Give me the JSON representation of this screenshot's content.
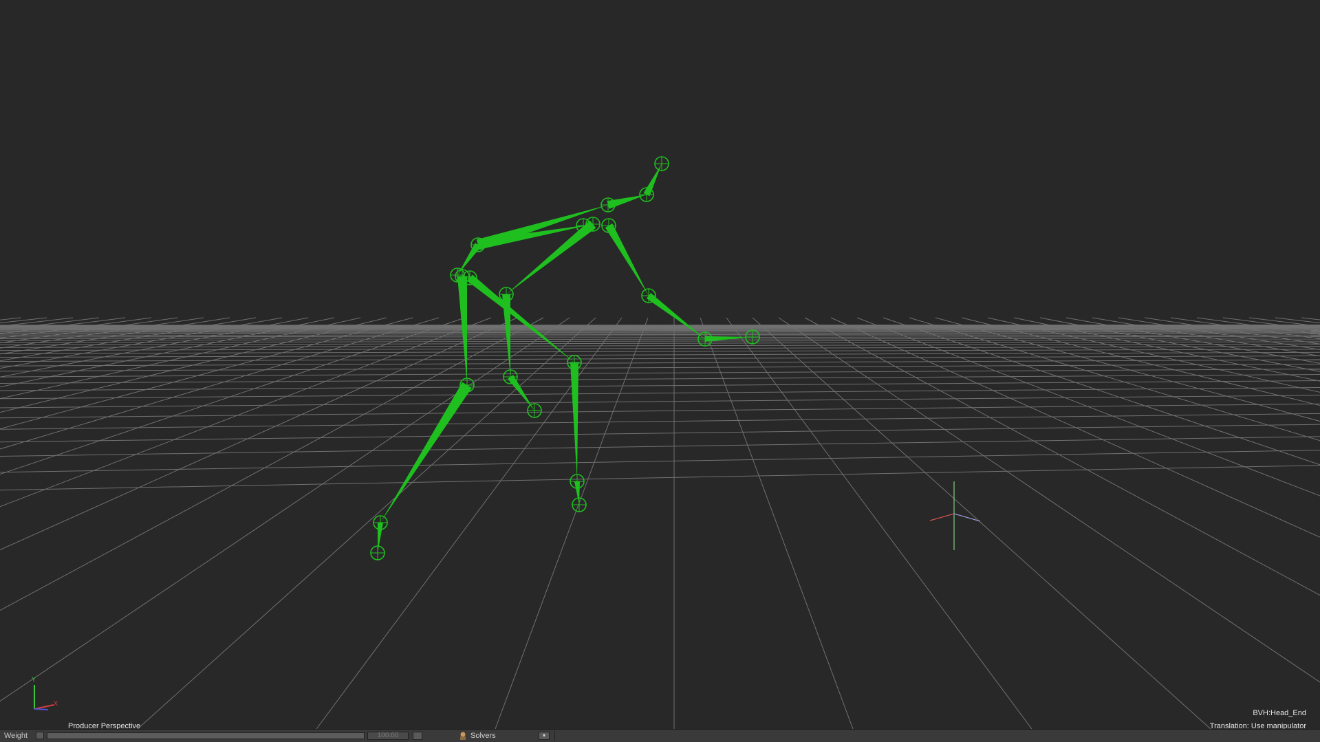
{
  "viewport": {
    "camera_label": "Producer Perspective",
    "selected_object": "BVH:Head_End",
    "status_text": "Translation: Use manipulator",
    "background_color": "#282828",
    "skeleton_color": "#1fbf1f",
    "grid_color": "#8a8a8a"
  },
  "axis_gizmo": {
    "y_label": "Y",
    "x_label": "X",
    "icon": "axis-gizmo-icon"
  },
  "bottom_bar": {
    "weight_label": "Weight",
    "weight_value": "100.00",
    "weight_fraction": 1.0,
    "solvers_label": "Solvers",
    "solvers_icon": "solvers-icon"
  }
}
